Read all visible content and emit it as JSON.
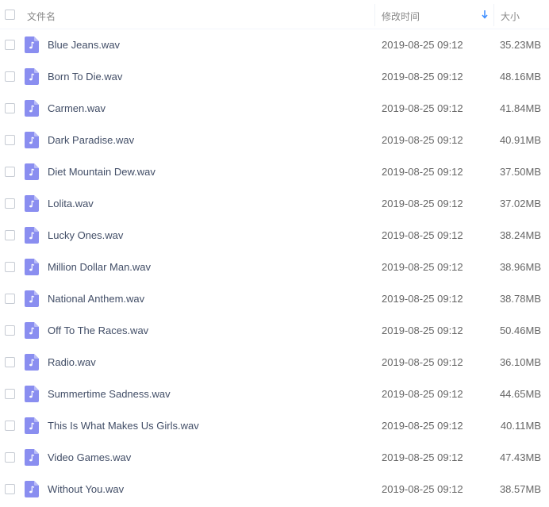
{
  "header": {
    "name_label": "文件名",
    "mtime_label": "修改时间",
    "size_label": "大小",
    "sort_icon": "arrow-down-icon",
    "accent_color": "#3b8cff"
  },
  "file_icon": {
    "name": "music-note-icon",
    "color": "#8a8ef0"
  },
  "files": [
    {
      "name": "Blue Jeans.wav",
      "mtime": "2019-08-25 09:12",
      "size": "35.23MB"
    },
    {
      "name": "Born To Die.wav",
      "mtime": "2019-08-25 09:12",
      "size": "48.16MB"
    },
    {
      "name": "Carmen.wav",
      "mtime": "2019-08-25 09:12",
      "size": "41.84MB"
    },
    {
      "name": "Dark Paradise.wav",
      "mtime": "2019-08-25 09:12",
      "size": "40.91MB"
    },
    {
      "name": "Diet Mountain Dew.wav",
      "mtime": "2019-08-25 09:12",
      "size": "37.50MB"
    },
    {
      "name": "Lolita.wav",
      "mtime": "2019-08-25 09:12",
      "size": "37.02MB"
    },
    {
      "name": "Lucky Ones.wav",
      "mtime": "2019-08-25 09:12",
      "size": "38.24MB"
    },
    {
      "name": "Million Dollar Man.wav",
      "mtime": "2019-08-25 09:12",
      "size": "38.96MB"
    },
    {
      "name": "National Anthem.wav",
      "mtime": "2019-08-25 09:12",
      "size": "38.78MB"
    },
    {
      "name": "Off To The Races.wav",
      "mtime": "2019-08-25 09:12",
      "size": "50.46MB"
    },
    {
      "name": "Radio.wav",
      "mtime": "2019-08-25 09:12",
      "size": "36.10MB"
    },
    {
      "name": "Summertime Sadness.wav",
      "mtime": "2019-08-25 09:12",
      "size": "44.65MB"
    },
    {
      "name": "This Is What Makes Us Girls.wav",
      "mtime": "2019-08-25 09:12",
      "size": "40.11MB"
    },
    {
      "name": "Video Games.wav",
      "mtime": "2019-08-25 09:12",
      "size": "47.43MB"
    },
    {
      "name": "Without You.wav",
      "mtime": "2019-08-25 09:12",
      "size": "38.57MB"
    }
  ]
}
